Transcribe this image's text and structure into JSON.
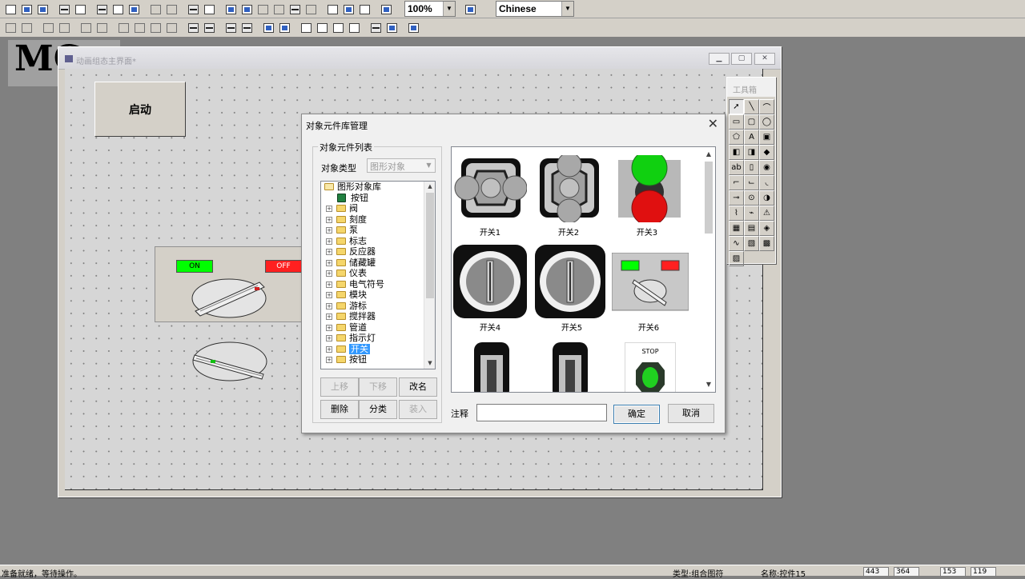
{
  "toolbar": {
    "zoom_value": "100%",
    "language_value": "Chinese"
  },
  "background": {
    "big_title": "MC"
  },
  "mdi": {
    "title": "动画组态主界面*",
    "start_button_label": "启动",
    "lamp_on_label": "ON",
    "lamp_off_label": "OFF"
  },
  "toolbox": {
    "title": "工具箱"
  },
  "dialog": {
    "title": "对象元件库管理",
    "list_group_label": "对象元件列表",
    "type_label": "对象类型",
    "type_value": "图形对象",
    "tree": {
      "root": "图形对象库",
      "first_leaf": "按钮",
      "folders": [
        "阀",
        "刻度",
        "泵",
        "标志",
        "反应器",
        "储藏罐",
        "仪表",
        "电气符号",
        "模块",
        "游标",
        "搅拌器",
        "管道",
        "指示灯",
        "开关",
        "按钮"
      ],
      "selected": "开关"
    },
    "buttons": {
      "move_up": "上移",
      "move_down": "下移",
      "rename": "改名",
      "delete": "删除",
      "classify": "分类",
      "load": "装入",
      "ok": "确定",
      "cancel": "取消"
    },
    "note_label": "注释",
    "items": [
      {
        "caption": "开关1"
      },
      {
        "caption": "开关2"
      },
      {
        "caption": "开关3"
      },
      {
        "caption": "开关4"
      },
      {
        "caption": "开关5"
      },
      {
        "caption": "开关6"
      }
    ],
    "stop_label": "STOP",
    "switch6_on": "ON",
    "switch6_off": "OFF"
  },
  "statusbar": {
    "message": "准备就绪，等待操作。",
    "type_text": "类型:组合图符",
    "name_text": "名称:控件15",
    "x": "443",
    "y": "364",
    "w": "153",
    "h": "119"
  },
  "colors": {
    "lamp_green": "#00ff00",
    "lamp_red": "#ff2020",
    "selection": "#3399ff"
  }
}
